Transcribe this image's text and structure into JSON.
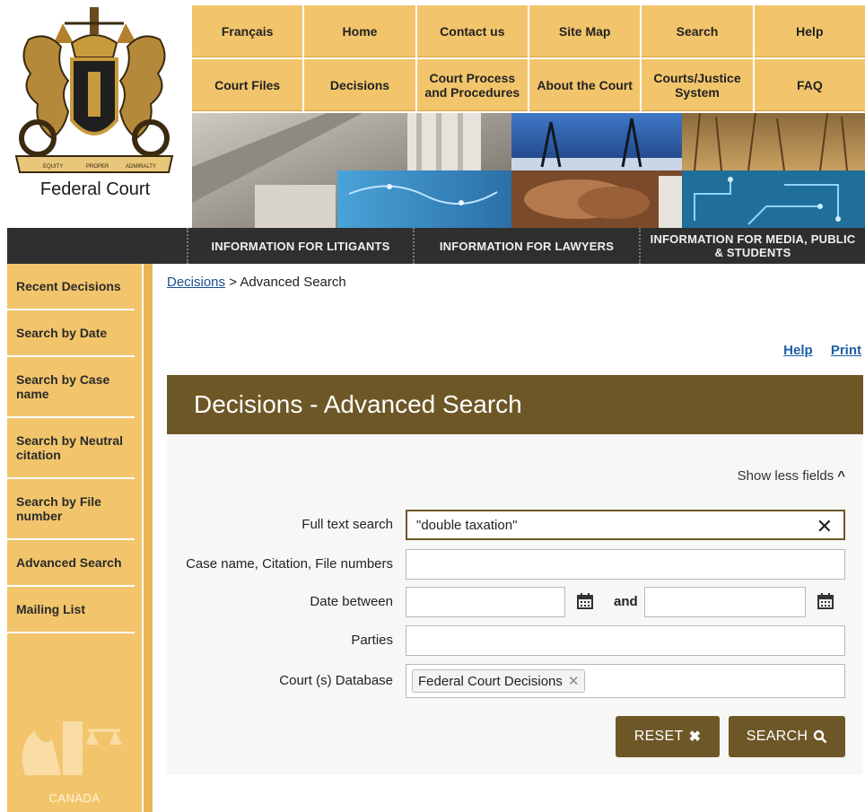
{
  "logo": {
    "caption": "Federal Court",
    "crest_scroll": [
      "EQUITY",
      "PROPER",
      "ADMIRALTY"
    ]
  },
  "topnav": [
    "Français",
    "Home",
    "Contact us",
    "Site Map",
    "Search",
    "Help",
    "Court Files",
    "Decisions",
    "Court Process and Procedures",
    "About the Court",
    "Courts/Justice System",
    "FAQ"
  ],
  "infobar": [
    "INFORMATION FOR LITIGANTS",
    "INFORMATION FOR LAWYERS",
    "INFORMATION FOR MEDIA, PUBLIC & STUDENTS"
  ],
  "sidebar": {
    "items": [
      "Recent Decisions",
      "Search by Date",
      "Search by Case name",
      "Search by Neutral citation",
      "Search by File number",
      "Advanced Search",
      "Mailing List"
    ],
    "footer": "CANADA"
  },
  "breadcrumb": {
    "link": "Decisions",
    "separator": " > ",
    "current": "Advanced Search"
  },
  "toplinks": {
    "help": "Help",
    "print": "Print"
  },
  "panel": {
    "title": "Decisions - Advanced Search",
    "toggle_fields": "Show less fields",
    "labels": {
      "full_text": "Full text search",
      "case_name": "Case name, Citation, File numbers",
      "date_between": "Date between",
      "and": "and",
      "parties": "Parties",
      "court_db": "Court (s) Database"
    },
    "values": {
      "full_text": "\"double taxation\"",
      "court_db_tag": "Federal Court Decisions"
    },
    "buttons": {
      "reset": "RESET",
      "search": "SEARCH"
    }
  },
  "colors": {
    "gold": "#f2c56c",
    "brown": "#6e5727",
    "dark_bar": "#2f2f2f",
    "link": "#1b5fa8"
  }
}
